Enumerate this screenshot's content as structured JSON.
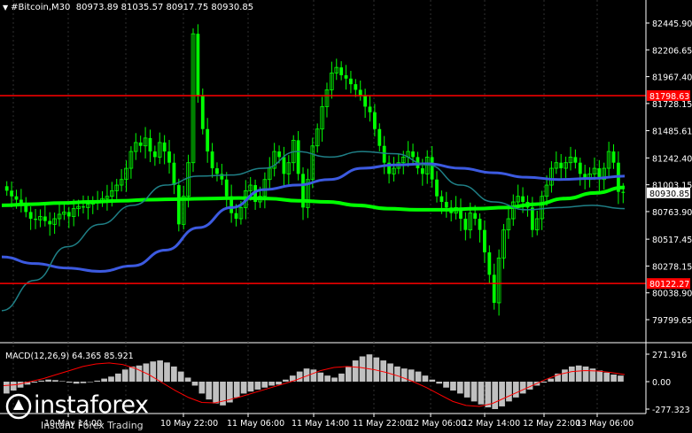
{
  "header": {
    "symbol": "#Bitcoin,M30",
    "ohlc": "80973.89 81035.57 80917.75 80930.85"
  },
  "watermark": {
    "brand": "instaforex",
    "tagline": "Instant Forex Trading",
    "icon": "instaforex-logo-icon"
  },
  "colors": {
    "background": "#000000",
    "bull_candle": "#00ff00",
    "bear_candle": "#00ff00",
    "ma_fast": "#00ff00",
    "ma_slow": "#3c5ae0",
    "ma_mid": "#1f7f86",
    "resistance": "#ff0000",
    "macd_hist": "#c0c0c0",
    "macd_signal": "#ff0000",
    "axis_text": "#ffffff"
  },
  "chart_data": [
    {
      "type": "candlestick",
      "title": "#Bitcoin,M30",
      "ylim": [
        79699.65,
        82582.0
      ],
      "y_ticks": [
        "82445.90",
        "82206.65",
        "81967.40",
        "81728.15",
        "81485.61",
        "81242.40",
        "81003.15",
        "80763.90",
        "80517.45",
        "80278.15",
        "80038.90",
        "79799.65"
      ],
      "x_ticks": [
        "10 May 14:00",
        "10 May 22:00",
        "11 May 06:00",
        "11 May 14:00",
        "11 May 22:00",
        "12 May 06:00",
        "12 May 14:00",
        "12 May 22:00",
        "13 May 06:00"
      ],
      "price_labels": [
        {
          "value": "81798.63",
          "kind": "level"
        },
        {
          "value": "80930.85",
          "kind": "current"
        },
        {
          "value": "80122.27",
          "kind": "level"
        }
      ],
      "levels": [
        81798.63,
        80122.27
      ],
      "current_price": 80930.85,
      "closes": [
        80950,
        80900,
        80870,
        80820,
        80760,
        80700,
        80690,
        80720,
        80680,
        80650,
        80700,
        80740,
        80760,
        80720,
        80790,
        80810,
        80800,
        80830,
        80850,
        80860,
        80880,
        80900,
        80950,
        81000,
        81050,
        81150,
        81300,
        81380,
        81350,
        81420,
        81300,
        81250,
        81380,
        81300,
        81200,
        81000,
        80650,
        80900,
        81200,
        82350,
        81800,
        81500,
        81300,
        81150,
        81100,
        81050,
        80900,
        80750,
        80700,
        80800,
        80950,
        81000,
        80850,
        80900,
        81050,
        81150,
        81300,
        81250,
        81100,
        81200,
        81400,
        81100,
        80800,
        81050,
        81350,
        81500,
        81700,
        81850,
        82000,
        82050,
        81980,
        81950,
        81900,
        81850,
        81800,
        81700,
        81650,
        81500,
        81350,
        81200,
        81100,
        81150,
        81200,
        81250,
        81300,
        81250,
        81150,
        81100,
        81250,
        81050,
        80900,
        80850,
        80800,
        80750,
        80800,
        80700,
        80600,
        80750,
        80700,
        80600,
        80400,
        80200,
        79950,
        80350,
        80600,
        80700,
        80850,
        80900,
        80850,
        80800,
        80600,
        80700,
        80900,
        81000,
        81150,
        81200,
        81150,
        81200,
        81250,
        81200,
        81100,
        81050,
        81100,
        81150,
        81050,
        81150,
        81300,
        81200,
        80940,
        80931
      ],
      "series": [
        {
          "name": "MA fast",
          "values": [
            80820,
            80830,
            80840,
            80850,
            80860,
            80870,
            80875,
            80880,
            80885,
            80880,
            80860,
            80850,
            80820,
            80790,
            80780,
            80780,
            80790,
            80800,
            80830,
            80880,
            80930,
            80980
          ]
        },
        {
          "name": "MA slow",
          "values": [
            80360,
            80300,
            80260,
            80230,
            80280,
            80420,
            80620,
            80800,
            80960,
            81000,
            81050,
            81150,
            81180,
            81190,
            81150,
            81110,
            81070,
            81050,
            81060,
            81080
          ]
        },
        {
          "name": "MA mid",
          "values": [
            79880,
            80150,
            80450,
            80650,
            80820,
            81000,
            81080,
            81090,
            81150,
            81300,
            81250,
            81300,
            81280,
            81180,
            81000,
            80850,
            80780,
            80800,
            80820,
            80790
          ]
        }
      ]
    },
    {
      "type": "bar",
      "title": "MACD(12,26,9) 64.365 85.921",
      "ylabel": "MACD(12,26,9)",
      "indicator_values": [
        "64.365",
        "85.921"
      ],
      "y_ticks": [
        "271.916",
        "0.00",
        "-277.323"
      ],
      "ylim": [
        -277.323,
        271.916
      ],
      "histogram": [
        -120,
        -90,
        -60,
        -30,
        -10,
        10,
        20,
        15,
        5,
        -10,
        -20,
        -15,
        -5,
        10,
        30,
        50,
        80,
        120,
        150,
        160,
        180,
        200,
        210,
        190,
        150,
        100,
        40,
        -40,
        -120,
        -180,
        -220,
        -240,
        -210,
        -160,
        -120,
        -100,
        -80,
        -60,
        -40,
        -30,
        20,
        60,
        100,
        130,
        120,
        90,
        60,
        40,
        80,
        150,
        210,
        250,
        270,
        240,
        210,
        180,
        150,
        130,
        120,
        100,
        60,
        20,
        -20,
        -60,
        -90,
        -120,
        -160,
        -200,
        -230,
        -260,
        -277,
        -250,
        -200,
        -160,
        -120,
        -80,
        -40,
        -10,
        30,
        80,
        120,
        150,
        160,
        150,
        130,
        110,
        90,
        70,
        60
      ],
      "signal": [
        -40,
        -30,
        0,
        30,
        70,
        110,
        150,
        175,
        185,
        170,
        130,
        70,
        -10,
        -90,
        -160,
        -210,
        -215,
        -185,
        -150,
        -110,
        -70,
        -30,
        10,
        60,
        110,
        140,
        150,
        140,
        120,
        90,
        50,
        0,
        -60,
        -130,
        -200,
        -240,
        -250,
        -220,
        -160,
        -100,
        -40,
        20,
        70,
        100,
        110,
        105,
        90,
        70
      ]
    }
  ]
}
